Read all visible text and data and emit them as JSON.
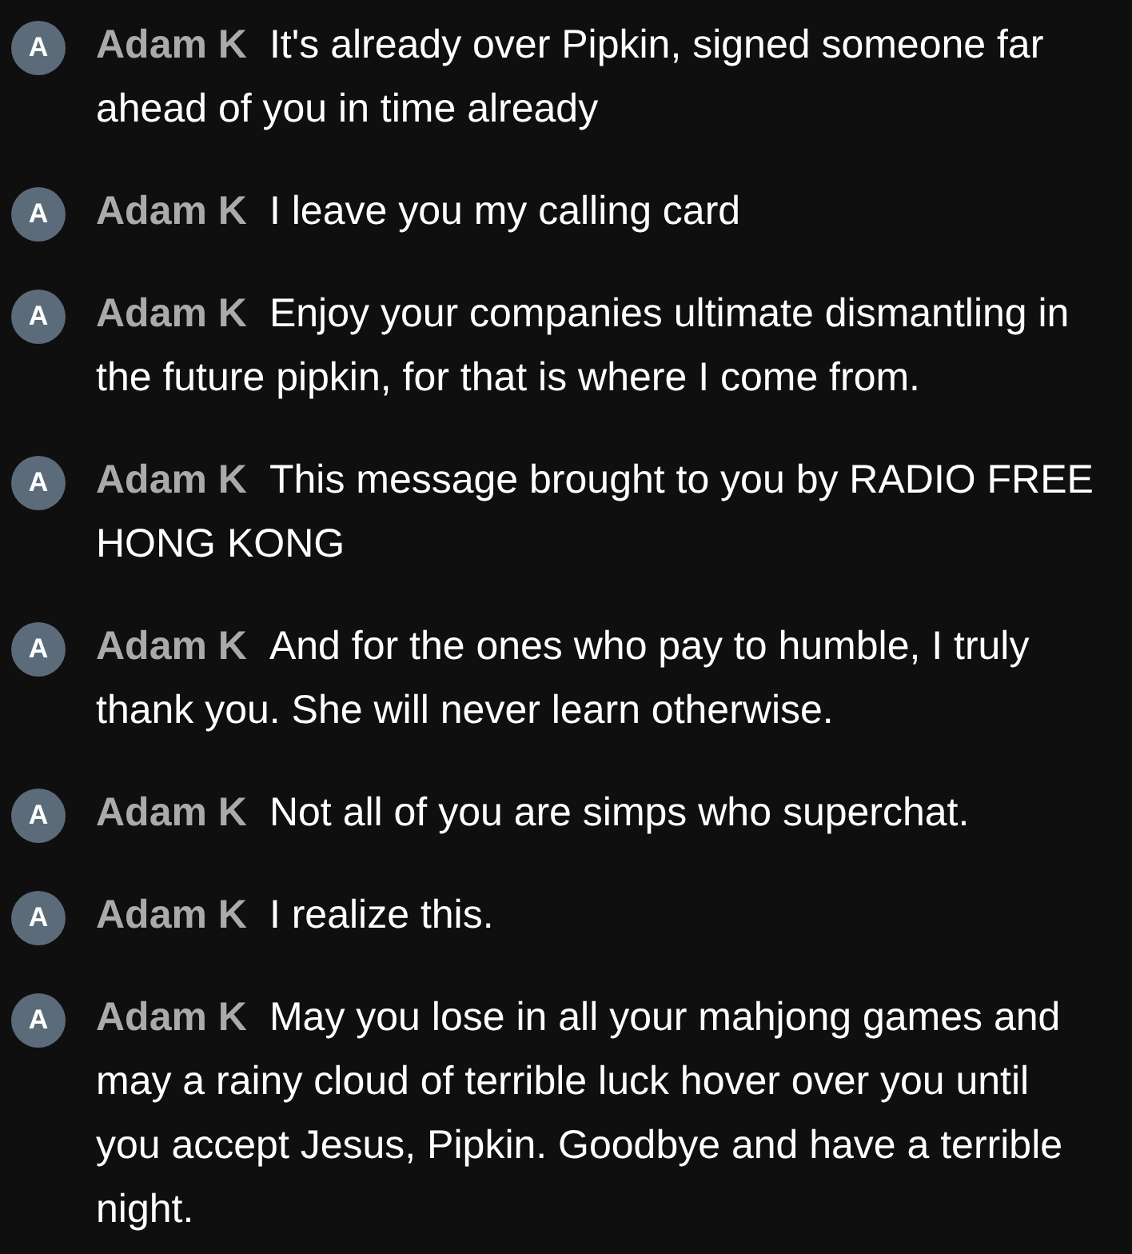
{
  "messages": [
    {
      "avatar_letter": "A",
      "author": "Adam K",
      "text": "It's already over Pipkin, signed someone far ahead of you in time already"
    },
    {
      "avatar_letter": "A",
      "author": "Adam K",
      "text": "I leave you my calling card"
    },
    {
      "avatar_letter": "A",
      "author": "Adam K",
      "text": "Enjoy your companies ultimate dismantling in the future pipkin, for that is where I come from."
    },
    {
      "avatar_letter": "A",
      "author": "Adam K",
      "text": "This message brought to you by RADIO FREE HONG KONG"
    },
    {
      "avatar_letter": "A",
      "author": "Adam K",
      "text": "And for the ones who pay to humble, I truly thank you. She will never learn otherwise."
    },
    {
      "avatar_letter": "A",
      "author": "Adam K",
      "text": "Not all of you are simps who superchat."
    },
    {
      "avatar_letter": "A",
      "author": "Adam K",
      "text": "I realize this."
    },
    {
      "avatar_letter": "A",
      "author": "Adam K",
      "text": "May you lose in all your mahjong games and may a rainy cloud of terrible luck hover over you until you accept Jesus, Pipkin. Goodbye and have a terrible night."
    }
  ]
}
